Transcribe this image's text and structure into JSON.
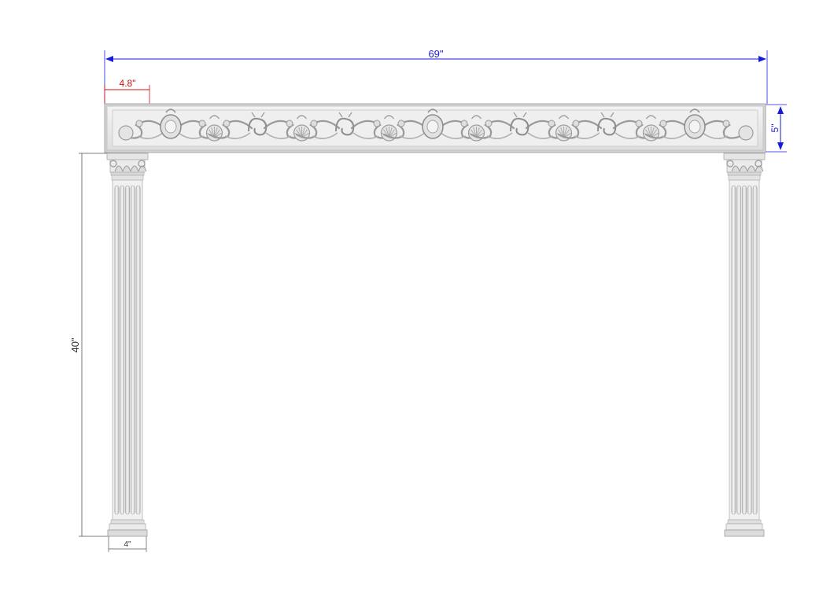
{
  "dimensions": {
    "overall_width": {
      "label": "69\"",
      "color": "#1a1adb"
    },
    "panel_height": {
      "label": "5\"",
      "color": "#1a1adb"
    },
    "ornament_offset": {
      "label": "4.8\"",
      "color": "#d01010"
    },
    "column_height": {
      "label": "40\"",
      "color": "#333333"
    },
    "column_width": {
      "label": "4\"",
      "color": "#333333"
    }
  },
  "colors": {
    "stone": "#ececec",
    "stone_shade": "#c8c8c8",
    "stone_dark": "#9c9c9c",
    "outline": "#b8b8b8"
  },
  "frieze": {
    "ornament_count": 7,
    "shell_pattern": [
      "cartouche",
      "scroll",
      "scroll",
      "cartouche",
      "scroll",
      "scroll",
      "cartouche"
    ]
  }
}
